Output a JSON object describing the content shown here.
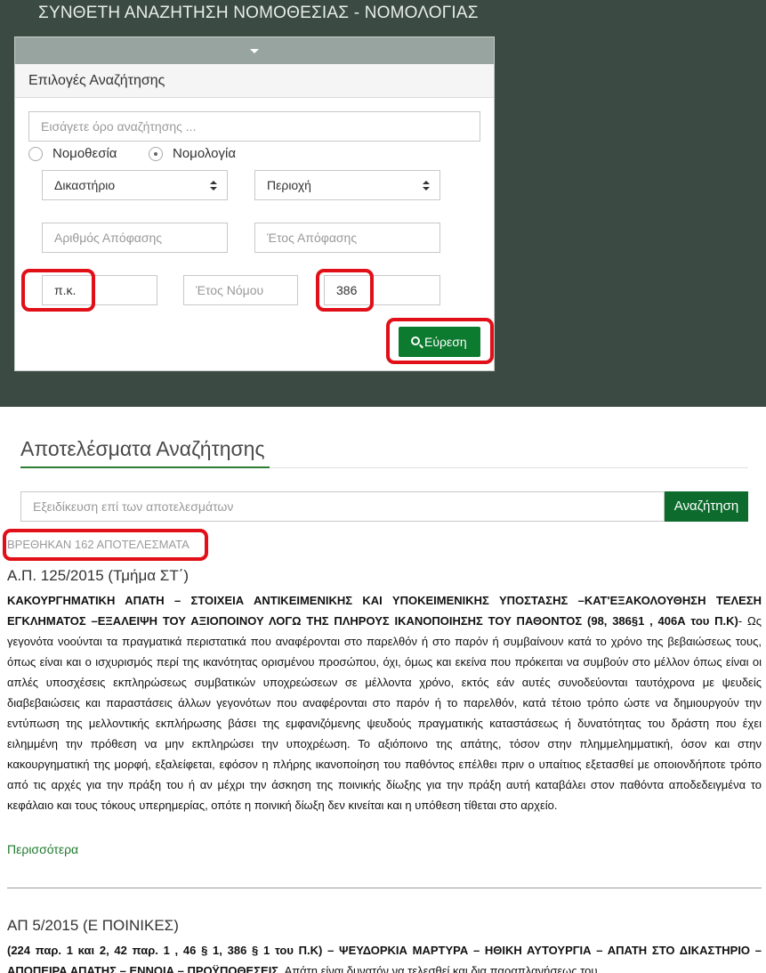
{
  "header": {
    "title": "ΣΥΝΘΕΤΗ ΑΝΑΖΗΤΗΣΗ ΝΟΜΟΘΕΣΙΑΣ - ΝΟΜΟΛΟΓΙΑΣ"
  },
  "search_panel": {
    "heading": "Επιλογές Αναζήτησης",
    "query_placeholder": "Εισάγετε όρο αναζήτησης ...",
    "radios": [
      {
        "label": "Νομοθεσία",
        "checked": false
      },
      {
        "label": "Νομολογία",
        "checked": true
      }
    ],
    "court_select": "Δικαστήριο",
    "area_select": "Περιοχή",
    "decision_number_placeholder": "Αριθμός Απόφασης",
    "decision_year_placeholder": "Έτος Απόφασης",
    "law_code_value": "π.κ.",
    "law_year_placeholder": "Έτος Νόμου",
    "article_value": "386",
    "find_button": "Εύρεση"
  },
  "results": {
    "heading": "Αποτελέσματα Αναζήτησης",
    "refine_placeholder": "Εξειδίκευση επί των αποτελεσμάτων",
    "refine_button": "Αναζήτηση",
    "count_text": "ΒΡΕΘΗΚΑΝ 162 ΑΠΟΤΕΛΕΣΜΑΤΑ",
    "items": [
      {
        "title": "Α.Π. 125/2015 (Τμήμα ΣΤ΄)",
        "summary_bold": "ΚΑΚΟΥΡΓΗΜΑΤΙΚΗ ΑΠΑΤΗ – ΣΤΟΙΧΕΙΑ ΑΝΤΙΚΕΙΜΕΝΙΚΗΣ ΚΑΙ ΥΠΟΚΕΙΜΕΝΙΚΗΣ ΥΠΟΣΤΑΣΗΣ –ΚΑΤ'ΕΞΑΚΟΛΟΥΘΗΣΗ ΤΕΛΕΣΗ ΕΓΚΛΗΜΑΤΟΣ –ΕΞΑΛΕΙΨΗ ΤΟΥ ΑΞΙΟΠΟΙΝΟΥ ΛΟΓΩ ΤΗΣ ΠΛΗΡΟΥΣ ΙΚΑΝΟΠΟΙΗΣΗΣ ΤΟΥ ΠΑΘΟΝΤΟΣ (98, 386§1 , 406Α του Π.Κ)",
        "summary_text": "- Ως γεγονότα νοούνται τα πραγματικά περιστατικά που αναφέρονται στο παρελθόν ή στο παρόν ή συμβαίνουν κατά το χρόνο της βεβαιώσεως τους, όπως είναι και ο ισχυρισμός περί της ικανότητας ορισμένου προσώπου, όχι, όμως και εκείνα που πρόκειται να συμβούν στο μέλλον όπως είναι οι απλές υποσχέσεις εκπληρώσεως συμβατικών υποχρεώσεων σε μέλλοντα χρόνο, εκτός εάν αυτές συνοδεύονται ταυτόχρονα με ψευδείς διαβεβαιώσεις και παραστάσεις άλλων γεγονότων που αναφέρονται στο παρόν ή το παρελθόν, κατά τέτοιο τρόπο ώστε να δημιουργούν την εντύπωση της μελλοντικής εκπλήρωσης βάσει της εμφανιζόμενης ψευδούς πραγματικής καταστάσεως ή δυνατότητας του δράστη που έχει ειλημμένη την πρόθεση να μην εκπληρώσει την υποχρέωση. Το αξιόποινο της απάτης, τόσον στην πλημμελημματική, όσον και στην κακουργηματική της μορφή, εξαλείφεται, εφόσον η πλήρης ικανοποίηση του παθόντος επέλθει πριν ο υπαίτιος εξετασθεί με οποιονδήποτε τρόπο από τις αρχές για την πράξη του ή αν μέχρι την άσκηση της ποινικής δίωξης για την πράξη αυτή καταβάλει στον παθόντα αποδεδειγμένα το κεφάλαιο και τους τόκους υπερημερίας, οπότε η ποινική δίωξη δεν κινείται και η υπόθεση τίθεται στο αρχείο.",
        "more": "Περισσότερα"
      },
      {
        "title": "ΑΠ 5/2015 (Ε ΠΟΙΝΙΚΕΣ)",
        "summary_bold": "(224 παρ. 1 και 2, 42 παρ. 1 , 46 § 1, 386 § 1 του Π.Κ) – ΨΕΥΔΟΡΚΙΑ ΜΑΡΤΥΡΑ – ΗΘΙΚΗ ΑΥΤΟΥΡΓΙΑ – ΑΠΑΤΗ ΣΤΟ ΔΙΚΑΣΤΗΡΙΟ –ΑΠΟΠΕΙΡΑ ΑΠΑΤΗΣ – ΕΝΝΟΙΑ – ΠΡΟΫΠΟΘΕΣΕΙΣ",
        "summary_text": ". Απάτη είναι δυνατόν να τελεσθεί και δια παραπλανήσεως του"
      }
    ]
  },
  "highlight_color": "#e10f18",
  "brand_green": "#0c7a2f"
}
